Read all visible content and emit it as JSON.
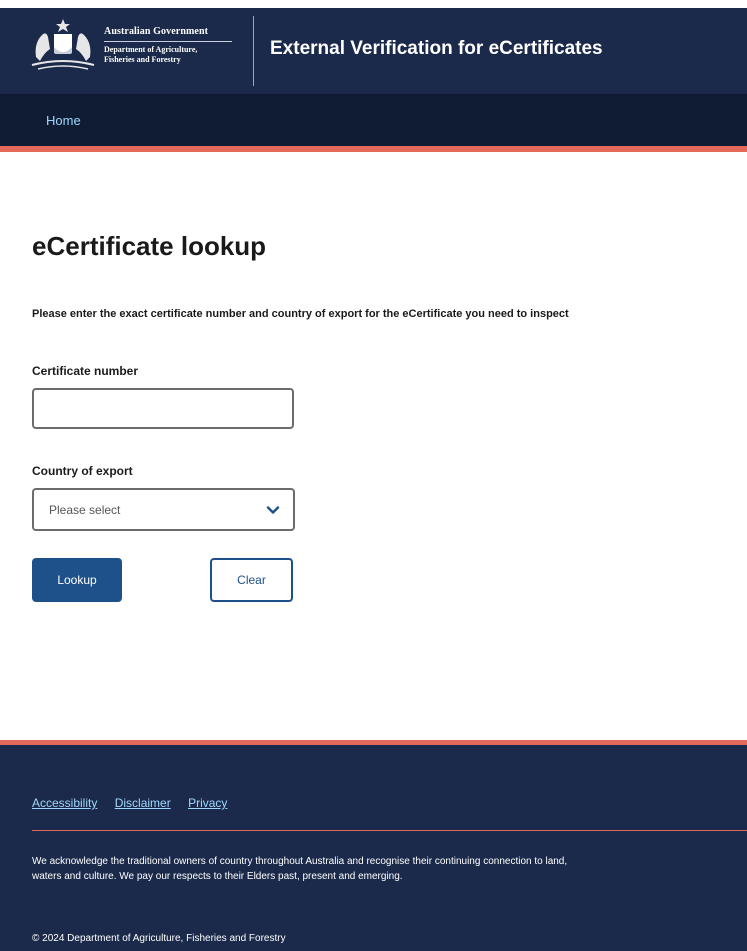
{
  "header": {
    "gov_name": "Australian Government",
    "dept_line1": "Department of Agriculture,",
    "dept_line2": "Fisheries and Forestry",
    "site_title": "External Verification for eCertificates",
    "crest_icon": "coat-of-arms-icon"
  },
  "nav": {
    "home_label": "Home"
  },
  "main": {
    "title": "eCertificate lookup",
    "instructions": "Please enter the exact certificate number and country of export for the eCertificate you need to inspect",
    "certificate_label": "Certificate number",
    "certificate_value": "",
    "country_label": "Country of export",
    "country_selected": "Please select",
    "dropdown_icon": "chevron-down-icon",
    "lookup_label": "Lookup",
    "clear_label": "Clear"
  },
  "footer": {
    "links": [
      "Accessibility",
      "Disclaimer",
      "Privacy"
    ],
    "acknowledgement": "We acknowledge the traditional owners of country throughout Australia and recognise their continuing connection to land, waters and culture. We pay our respects to their Elders past, present and emerging.",
    "copyright": "© 2024 Department of Agriculture, Fisheries and Forestry"
  },
  "colors": {
    "header_bg": "#1b2a4a",
    "nav_bg": "#0f1c34",
    "accent": "#e4695b",
    "button_primary": "#1e5189",
    "link": "#9fd8ff"
  }
}
